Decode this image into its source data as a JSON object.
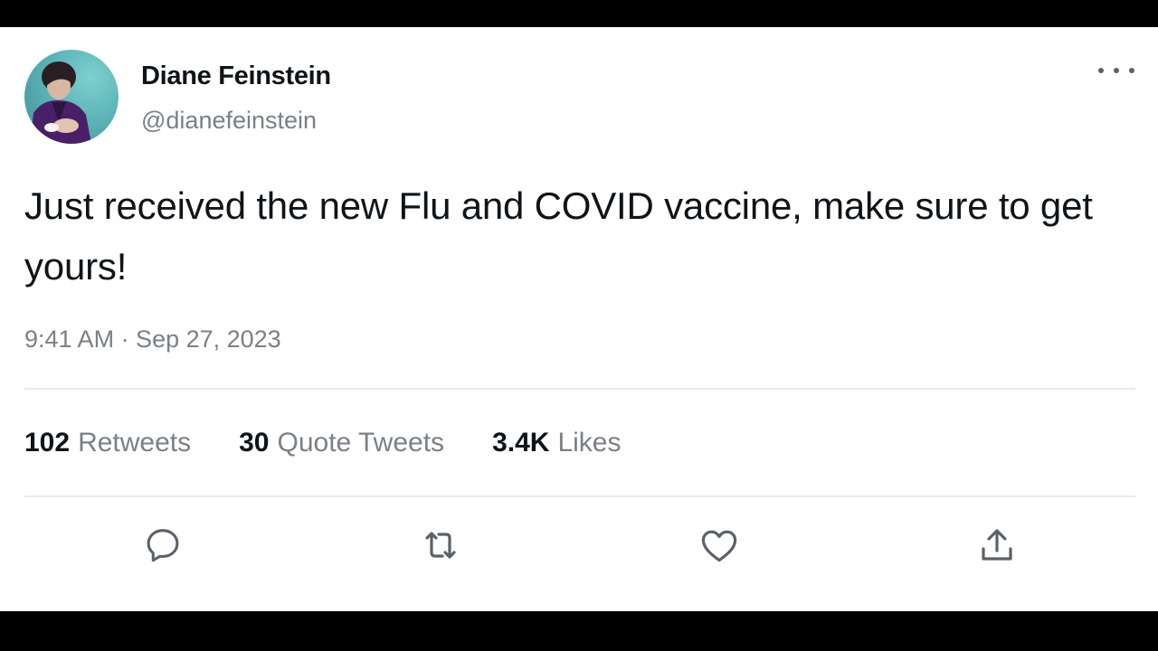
{
  "tweet": {
    "author": {
      "display_name": "Diane Feinstein",
      "handle": "@dianefeinstein"
    },
    "text": "Just received the new Flu and COVID vaccine, make sure to get yours!",
    "timestamp": "9:41 AM · Sep 27, 2023",
    "stats": [
      {
        "count": "102",
        "label": "Retweets"
      },
      {
        "count": "30",
        "label": "Quote Tweets"
      },
      {
        "count": "3.4K",
        "label": "Likes"
      }
    ],
    "actions": [
      "reply-icon",
      "retweet-icon",
      "like-icon",
      "share-icon"
    ]
  },
  "colors": {
    "text_primary": "#0f1419",
    "text_secondary": "#7a8086",
    "divider": "#e6e9ec",
    "letterbox": "#000000"
  }
}
